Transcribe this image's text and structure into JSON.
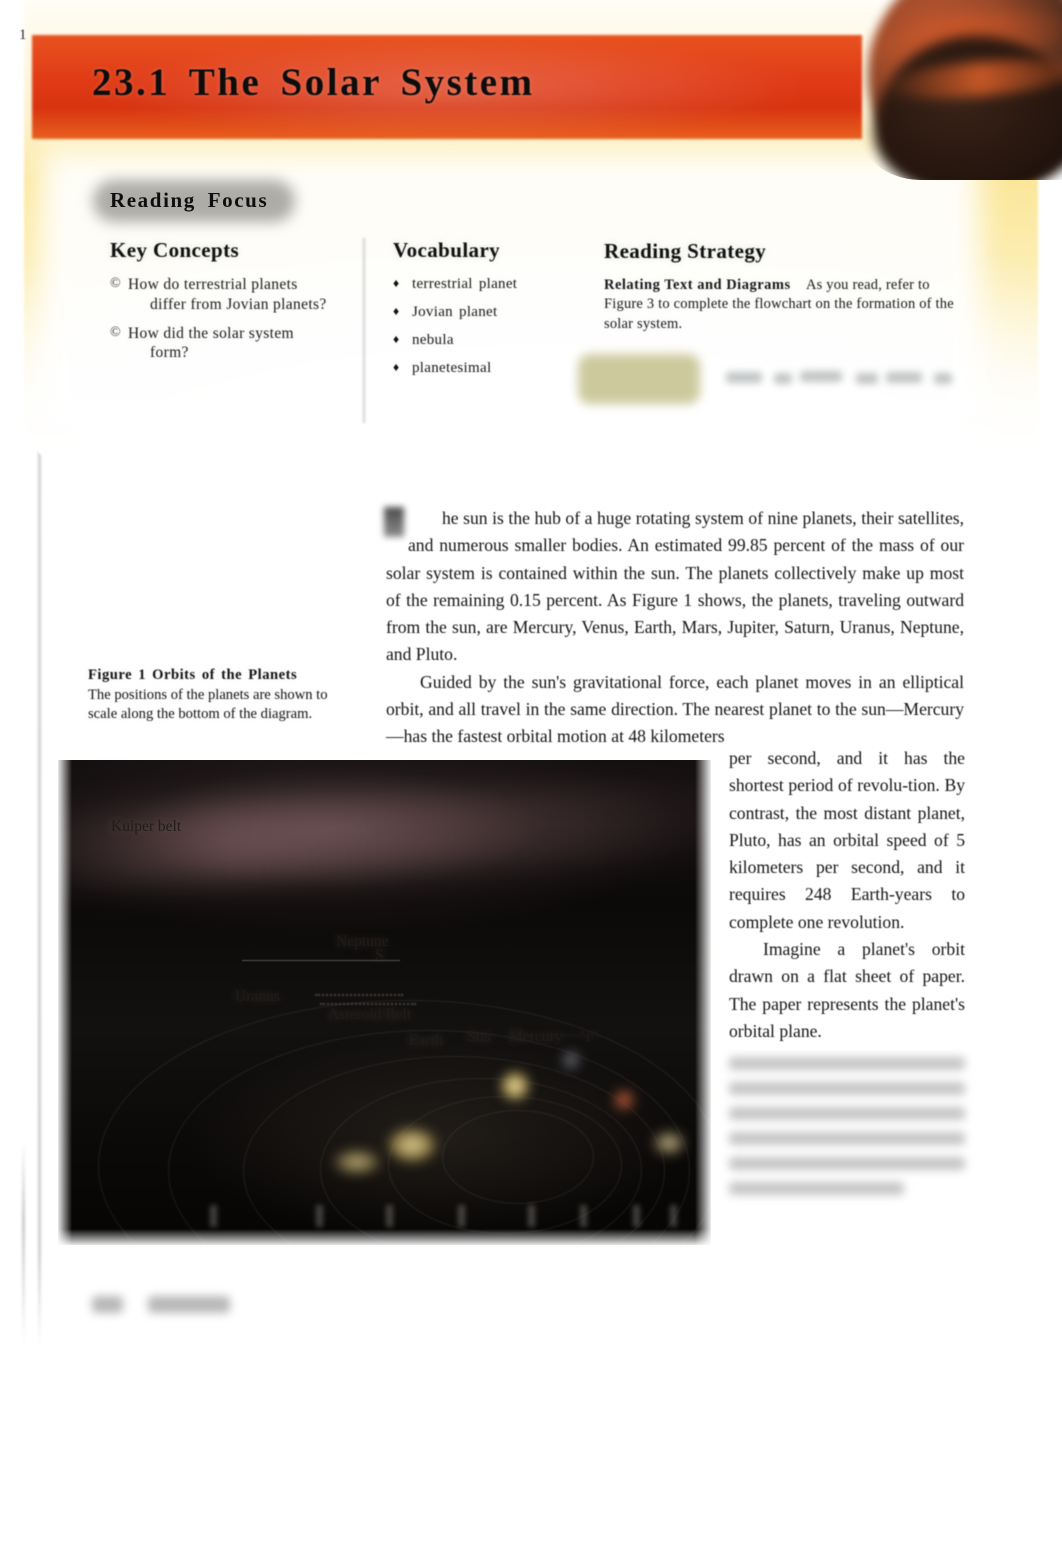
{
  "page": {
    "number": "1",
    "section_number": "23.1",
    "section_title": "23.1  The  Solar  System"
  },
  "reading_focus": {
    "pill_label": "Reading  Focus",
    "key_concepts": {
      "heading": "Key Concepts",
      "bullet_glyph": "©",
      "items": [
        {
          "line1": "How do terrestrial planets",
          "line2": "differ from Jovian planets?"
        },
        {
          "line1": "How did the solar system",
          "line2": "form?"
        }
      ]
    },
    "vocabulary": {
      "heading": "Vocabulary",
      "bullet_glyph": "♦",
      "items": [
        "terrestrial  planet",
        "Jovian  planet",
        "nebula",
        "planetesimal"
      ]
    },
    "reading_strategy": {
      "heading": "Reading Strategy",
      "strategy_name": "Relating Text and Diagrams",
      "body": "As you read, refer to Figure 3 to complete the flowchart on the formation of the solar system."
    }
  },
  "body": {
    "paragraph_1": "he sun is the hub of a huge rotating system of nine planets, their satellites, and numerous smaller bodies. An estimated 99.85 percent of the mass of our solar system is contained within the sun. The planets collectively make up most of the remaining 0.15 percent. As Figure 1 shows, the planets, traveling outward from the sun, are Mercury, Venus, Earth, Mars, Jupiter, Saturn, Uranus, Neptune, and Pluto.",
    "paragraph_2": "Guided by the sun's gravitational force, each planet moves in an elliptical orbit, and all travel in the same direction. The nearest planet to the sun—Mercury—has the fastest orbital motion at 48 kilometers",
    "paragraph_2_cont": "per second, and it has the shortest period of revolu-tion. By contrast, the most distant planet, Pluto, has an orbital speed of 5 kilometers per second, and it requires 248 Earth-years to complete one revolution.",
    "paragraph_3": "Imagine a planet's orbit drawn on a flat sheet of paper. The paper represents the planet's orbital plane."
  },
  "figure": {
    "caption_title": "Figure 1 Orbits of the Planets",
    "caption_body": "The positions of the planets are shown to scale along the bottom of the diagram.",
    "labels": [
      "Kuiper belt",
      "Neptune",
      "S",
      "Uranus",
      "Asteroid Belt",
      "Earth",
      "Sun",
      "Mercury~~^r^"
    ]
  },
  "colors": {
    "banner_red": "#e03a16",
    "cream": "#fbe79a",
    "figure_black": "#0a0806",
    "text_black": "#141414"
  }
}
